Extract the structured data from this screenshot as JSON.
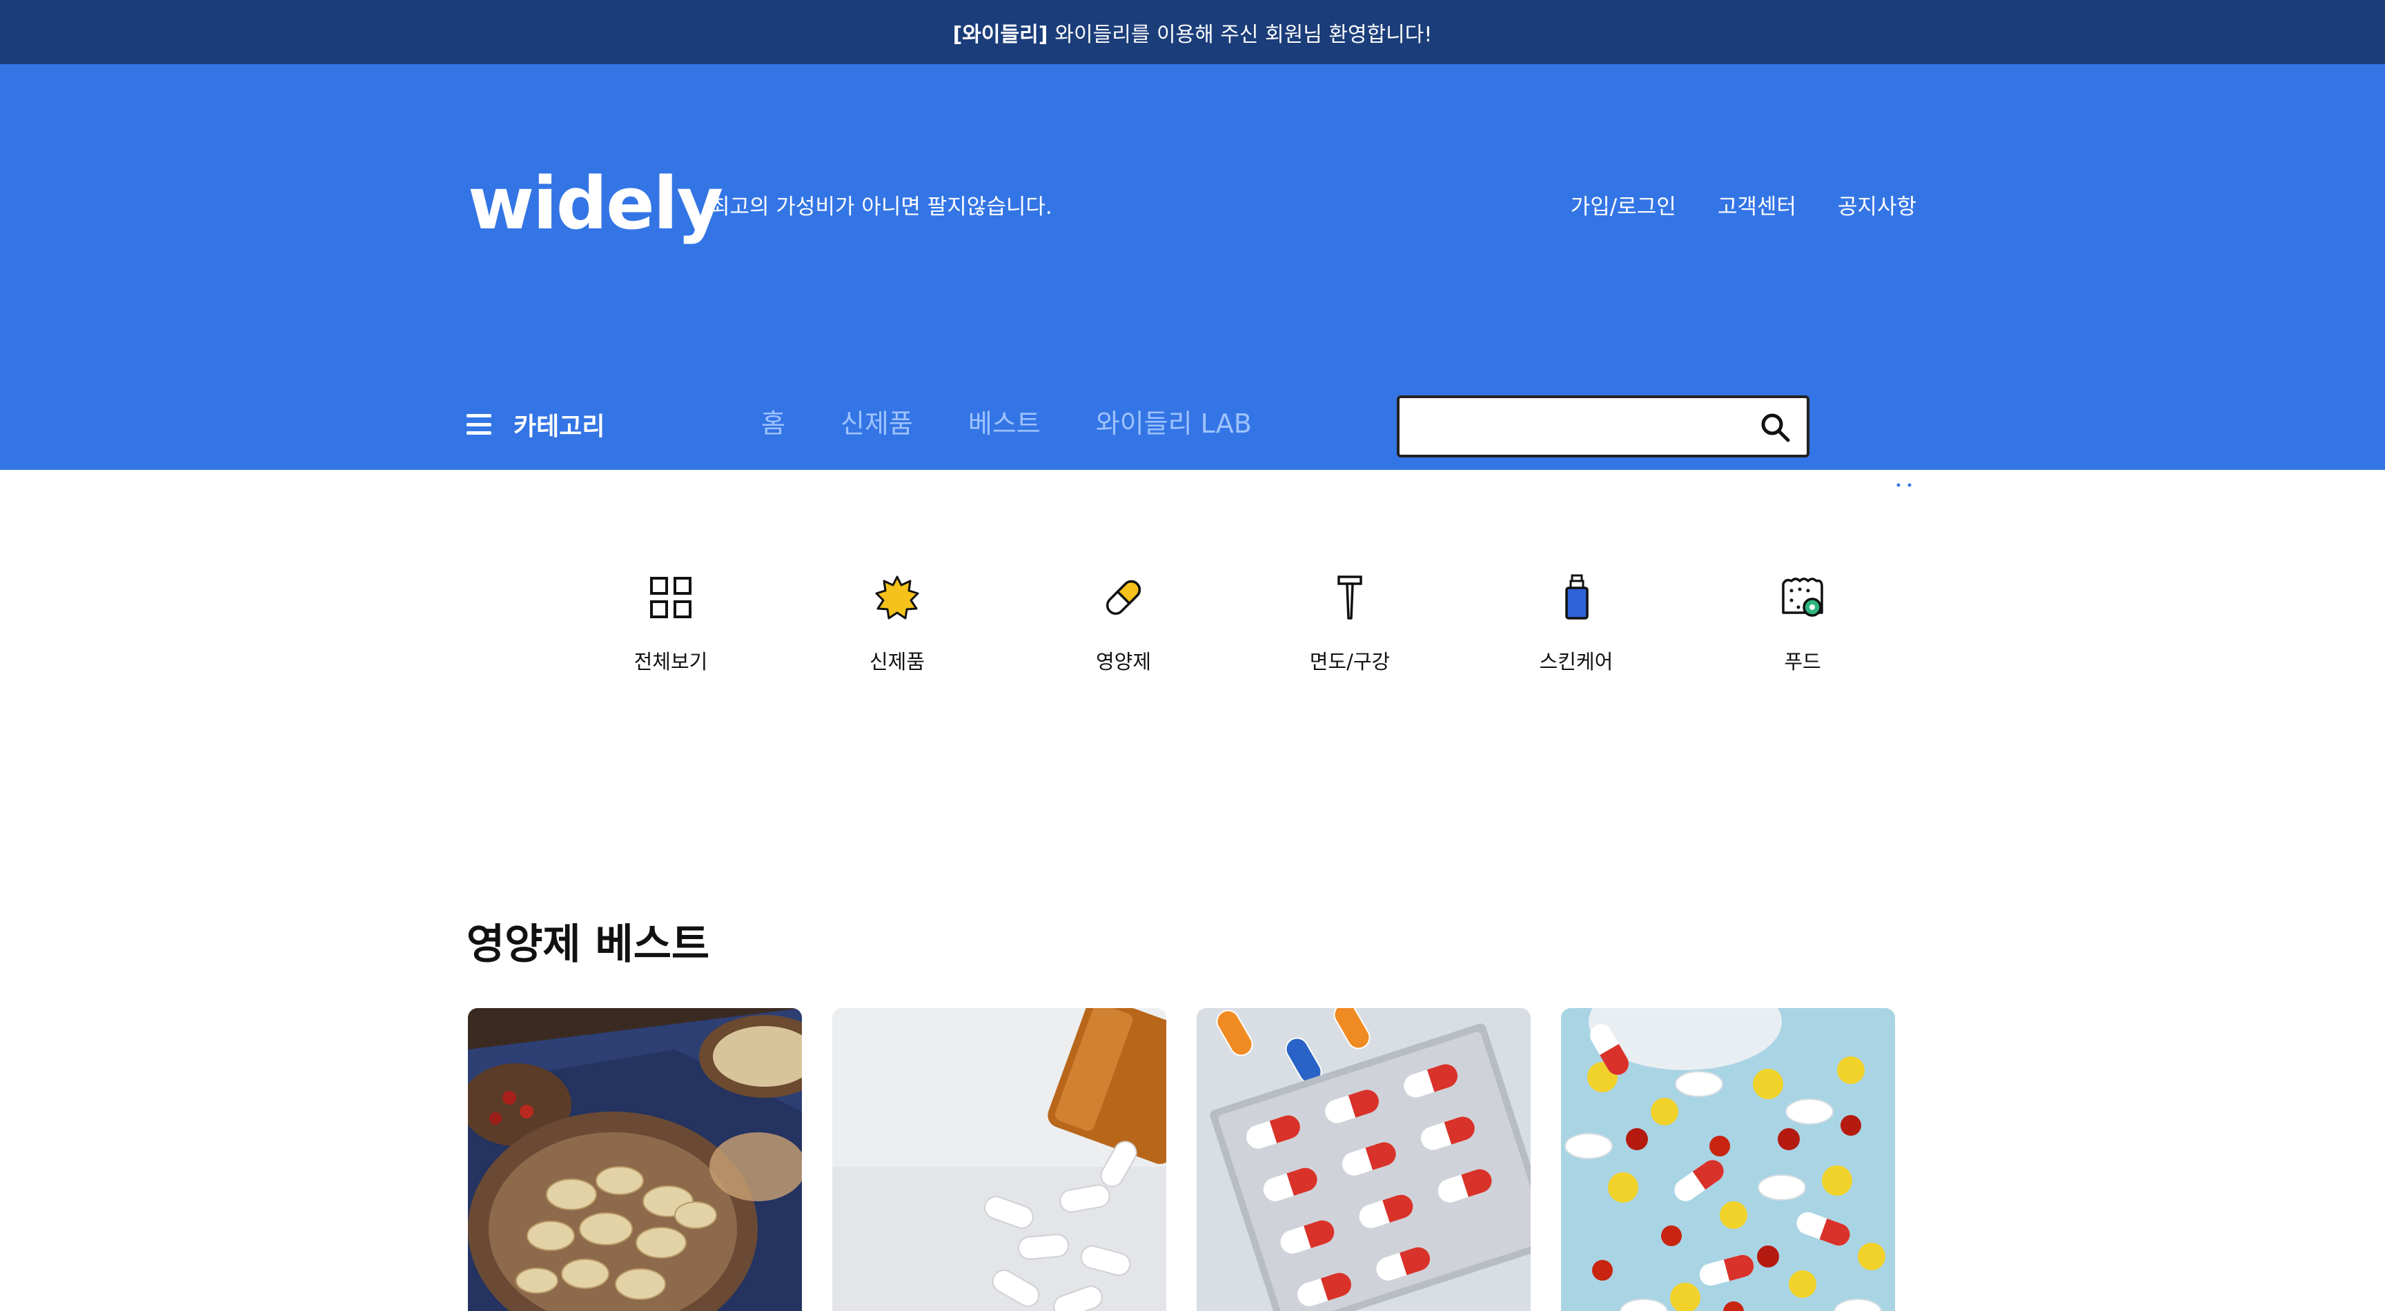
{
  "topbar": {
    "brand": "[와이들리]",
    "message": "와이들리를 이용해 주신 회원님 환영합니다!"
  },
  "header": {
    "logo": "widely",
    "tagline": "최고의 가성비가 아니면 팔지않습니다.",
    "util_links": [
      "가입/로그인",
      "고객센터",
      "공지사항"
    ],
    "category_label": "카테고리",
    "main_nav": [
      "홈",
      "신제품",
      "베스트",
      "와이들리 LAB"
    ],
    "search": {
      "value": "",
      "placeholder": ""
    }
  },
  "categories": [
    {
      "label": "전체보기",
      "icon": "grid-icon"
    },
    {
      "label": "신제품",
      "icon": "new-badge-icon"
    },
    {
      "label": "영양제",
      "icon": "pill-icon"
    },
    {
      "label": "면도/구강",
      "icon": "razor-icon"
    },
    {
      "label": "스킨케어",
      "icon": "lotion-bottle-icon"
    },
    {
      "label": "푸드",
      "icon": "cookie-icon"
    }
  ],
  "best_section": {
    "title": "영양제 베스트",
    "products": [
      {
        "image": "herbal-root-slices-photo"
      },
      {
        "image": "spilled-capsules-bottle-photo"
      },
      {
        "image": "red-capsule-blister-pack-photo"
      },
      {
        "image": "colorful-pills-pile-photo"
      }
    ]
  },
  "colors": {
    "topbar": "#1b3d7a",
    "header": "#3475e5",
    "nav_text": "#9ec2ff",
    "accent_yellow": "#f5c21b",
    "accent_blue": "#2f62d6"
  }
}
